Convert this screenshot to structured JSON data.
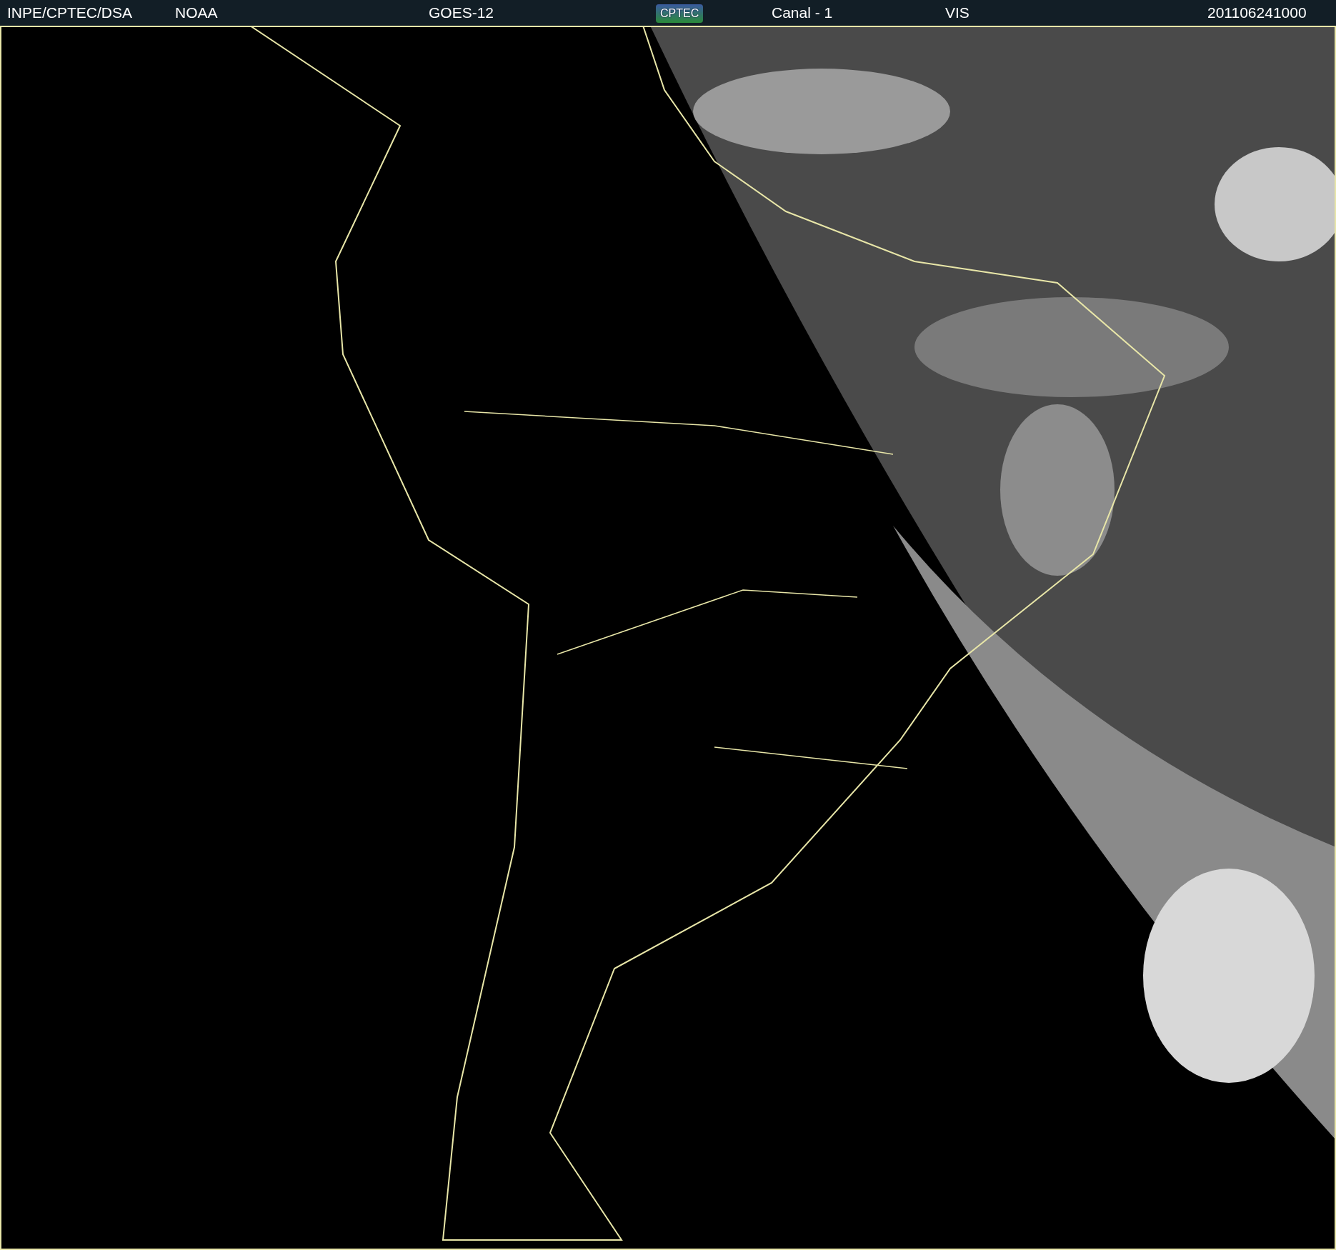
{
  "header": {
    "items": [
      {
        "kind": "text",
        "text": "INPE/CPTEC/DSA"
      },
      {
        "kind": "text",
        "text": "NOAA"
      },
      {
        "kind": "text",
        "text": "GOES-12"
      },
      {
        "kind": "logo",
        "text": "CPTEC"
      },
      {
        "kind": "text",
        "text": "Canal - 1"
      },
      {
        "kind": "text",
        "text": "VIS"
      },
      {
        "kind": "text",
        "text": "201106241000"
      }
    ]
  }
}
